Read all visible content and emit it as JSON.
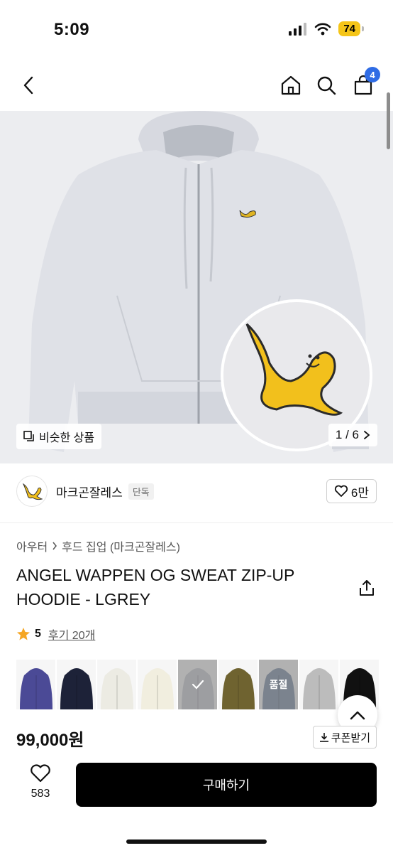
{
  "status": {
    "time": "5:09",
    "battery": "74"
  },
  "nav": {
    "cart_count": "4"
  },
  "gallery": {
    "similar_label": "비슷한 상품",
    "pager": "1 / 6"
  },
  "brand": {
    "name": "마크곤잘레스",
    "tag": "단독",
    "likes": "6만"
  },
  "breadcrumb": {
    "category": "아우터",
    "subcategory": "후드 집업 (마크곤잘레스)"
  },
  "product": {
    "title": "ANGEL WAPPEN OG SWEAT ZIP-UP HOODIE - LGREY",
    "rating": "5",
    "reviews": "후기 20개",
    "price": "99,000원",
    "coupon_label": "쿠폰받기"
  },
  "swatches": [
    {
      "color": "#4b4a96",
      "state": ""
    },
    {
      "color": "#1d2238",
      "state": ""
    },
    {
      "color": "#ecebe3",
      "state": ""
    },
    {
      "color": "#f1eedf",
      "state": ""
    },
    {
      "color": "#c9ccd3",
      "state": "selected"
    },
    {
      "color": "#6f6330",
      "state": ""
    },
    {
      "color": "#7f90a8",
      "state": "품절"
    },
    {
      "color": "#bcbcbc",
      "state": ""
    },
    {
      "color": "#111111",
      "state": ""
    }
  ],
  "bottom": {
    "wish_count": "583",
    "buy_label": "구매하기"
  },
  "colors": {
    "accent": "#2f6ce5",
    "star": "#f5a623",
    "buy": "#000000"
  }
}
